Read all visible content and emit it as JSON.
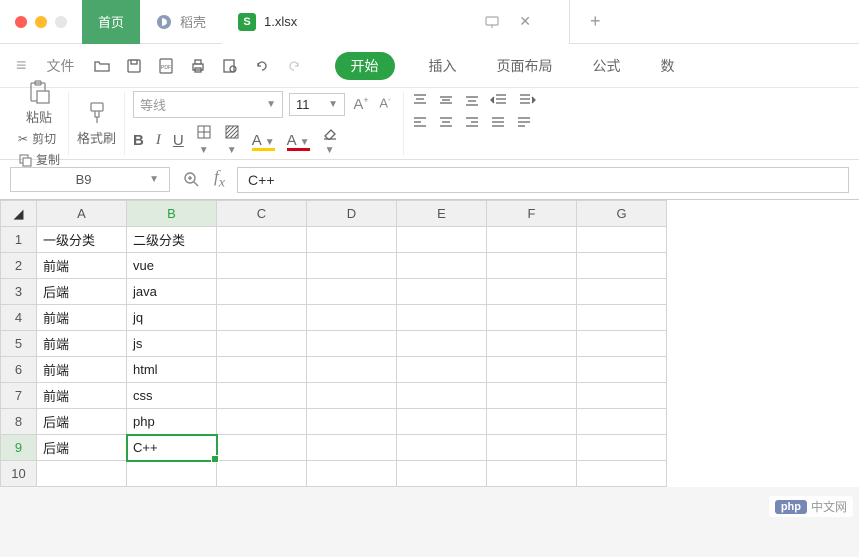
{
  "tabs": {
    "home": "首页",
    "daoke": "稻壳",
    "file": "1.xlsx"
  },
  "menu": {
    "file": "文件",
    "start": "开始",
    "insert": "插入",
    "page_layout": "页面布局",
    "formula": "公式",
    "data_partial": "数"
  },
  "ribbon": {
    "paste": "粘贴",
    "cut": "剪切",
    "copy": "复制",
    "format_brush": "格式刷",
    "font_name": "等线",
    "font_size": "11",
    "bold": "B",
    "italic": "I",
    "underline": "U",
    "font_increase": "A+",
    "font_decrease": "A-"
  },
  "formula_bar": {
    "cell_ref": "B9",
    "value": "C++"
  },
  "grid": {
    "columns": [
      "A",
      "B",
      "C",
      "D",
      "E",
      "F",
      "G"
    ],
    "rows": [
      {
        "n": "1",
        "A": "一级分类",
        "B": "二级分类"
      },
      {
        "n": "2",
        "A": "前端",
        "B": "vue"
      },
      {
        "n": "3",
        "A": "后端",
        "B": "java"
      },
      {
        "n": "4",
        "A": "前端",
        "B": "jq"
      },
      {
        "n": "5",
        "A": "前端",
        "B": "js"
      },
      {
        "n": "6",
        "A": "前端",
        "B": "html"
      },
      {
        "n": "7",
        "A": "前端",
        "B": "css"
      },
      {
        "n": "8",
        "A": "后端",
        "B": "php"
      },
      {
        "n": "9",
        "A": "后端",
        "B": "C++"
      },
      {
        "n": "10",
        "A": "",
        "B": ""
      }
    ],
    "selected": {
      "row": 9,
      "col": "B"
    }
  },
  "watermark": {
    "badge": "php",
    "text": "中文网"
  }
}
